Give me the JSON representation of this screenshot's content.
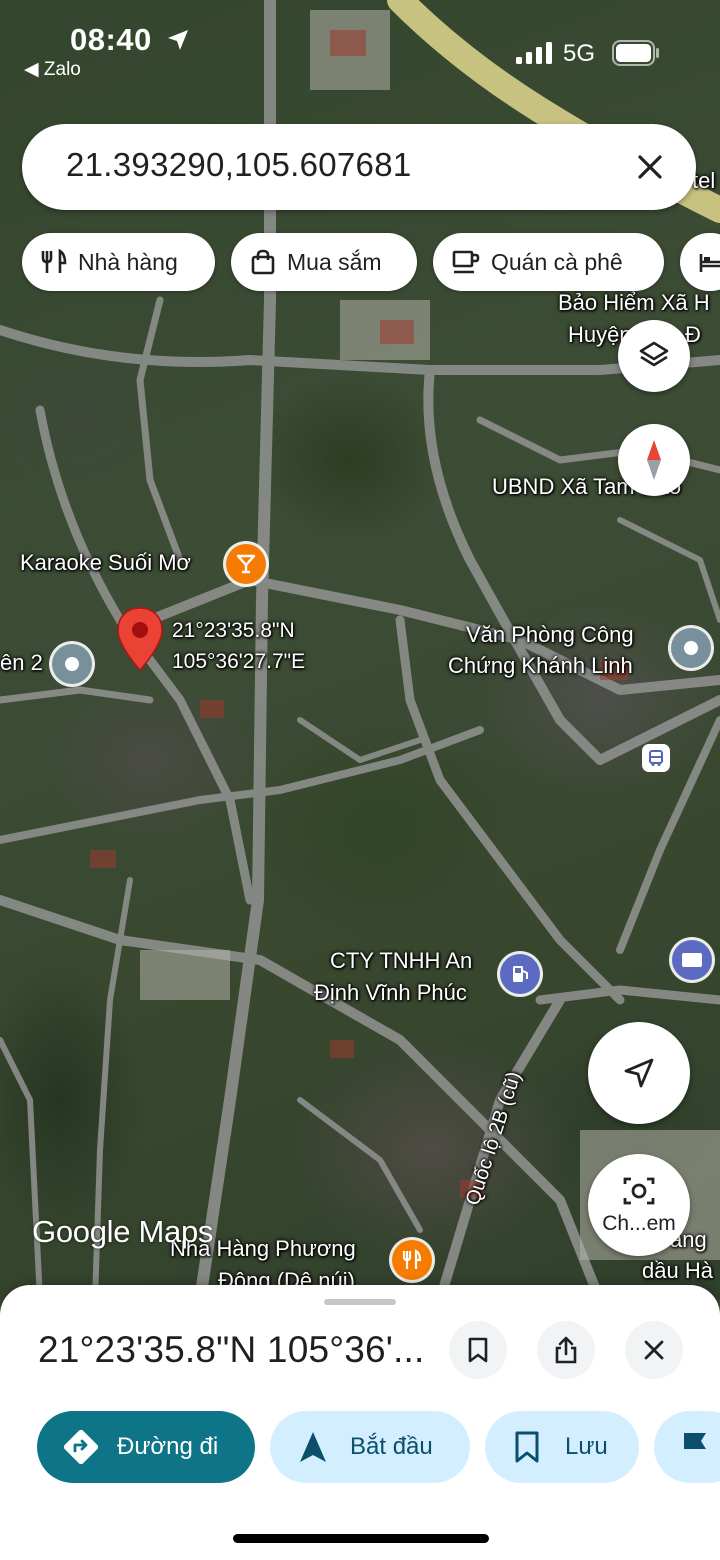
{
  "status_bar": {
    "time": "08:40",
    "back_app": "◀ Zalo",
    "network": "5G"
  },
  "search": {
    "query": "21.393290,105.607681"
  },
  "chips": [
    {
      "label": "Nhà hàng",
      "icon": "restaurant-icon"
    },
    {
      "label": "Mua sắm",
      "icon": "shopping-bag-icon"
    },
    {
      "label": "Quán cà phê",
      "icon": "coffee-icon"
    },
    {
      "label": "",
      "icon": "hotel-icon"
    }
  ],
  "map": {
    "labels": {
      "karaoke": "Karaoke Suối Mơ",
      "pin_lat": "21°23'35.8\"N",
      "pin_lng": "105°36'27.7\"E",
      "left_poi": "ên 2",
      "bao_hiem_1": "Bảo Hiểm Xã H",
      "bao_hiem_2": "Huyện Tam Đ",
      "ubnd": "UBND Xã Tam Đảo",
      "van_phong_1": "Văn Phòng Công",
      "van_phong_2": "Chứng Khánh Linh",
      "cty_1": "CTY TNHH An",
      "cty_2": "Định Vĩnh Phúc",
      "road": "Quốc lộ 2B (cũ)",
      "nha_hang_1": "Nhà Hàng Phương",
      "nha_hang_2": "Đông (Dê núi)",
      "right_edge_1": "ang",
      "right_edge_2": "dầu Hà",
      "top_right_edge": "tel"
    },
    "google_logo": "Google Maps",
    "lens_label": "Ch...em",
    "accent_colors": {
      "pin": "#ea4335",
      "poi_orange": "#f57c00",
      "poi_blue": "#5c6bc0",
      "poi_gray": "#78909c"
    }
  },
  "sheet": {
    "title": "21°23'35.8\"N 105°36'...",
    "actions": [
      {
        "label": "Đường đi",
        "icon": "directions-icon",
        "style": "primary"
      },
      {
        "label": "Bắt đầu",
        "icon": "navigation-arrow-icon",
        "style": "secondary"
      },
      {
        "label": "Lưu",
        "icon": "bookmark-icon",
        "style": "secondary"
      },
      {
        "label": "",
        "icon": "flag-icon",
        "style": "secondary"
      }
    ]
  }
}
